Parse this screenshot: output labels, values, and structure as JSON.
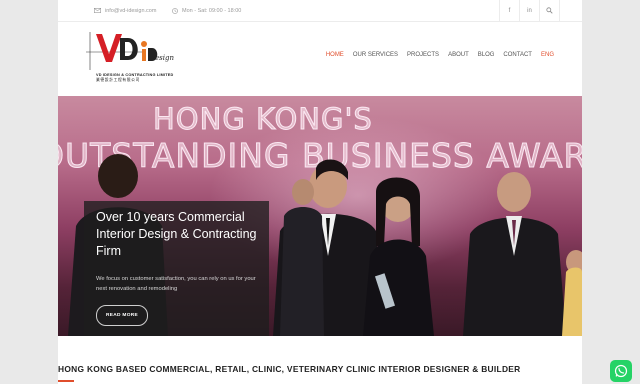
{
  "topbar": {
    "email": "info@vd-idesign.com",
    "hours": "Mon - Sat: 09:00 - 18:00",
    "icons": [
      "facebook-icon",
      "linkedin-icon",
      "search-icon"
    ],
    "facebook_glyph": "f",
    "linkedin_glyph": "in"
  },
  "logo": {
    "mark": "VD",
    "script": "iDesign",
    "company_en": "VD IDESIGN & CONTRACTING LIMITED",
    "company_zh": "業德設計工程有限公司"
  },
  "nav": {
    "items": [
      {
        "label": "HOME",
        "active": true
      },
      {
        "label": "OUR SERVICES",
        "active": false
      },
      {
        "label": "PROJECTS",
        "active": false
      },
      {
        "label": "ABOUT",
        "active": false
      },
      {
        "label": "BLOG",
        "active": false
      },
      {
        "label": "CONTACT",
        "active": false
      }
    ],
    "language": "ENG"
  },
  "hero": {
    "banner_line1": "HONG KONG'S",
    "banner_line2": "OUTSTANDING BUSINESS AWARDS",
    "caption_title": "Over 10 years Commercial Interior Design & Contracting Firm",
    "caption_text": "We focus on customer satisfaction, you can rely on us for your next renovation and remodeling",
    "cta_label": "READ MORE"
  },
  "section": {
    "heading": "HONG KONG BASED COMMERCIAL, RETAIL, CLINIC, VETERINARY CLINIC INTERIOR DESIGNER & BUILDER"
  },
  "colors": {
    "accent": "#e04e2c",
    "whatsapp": "#25d366"
  }
}
